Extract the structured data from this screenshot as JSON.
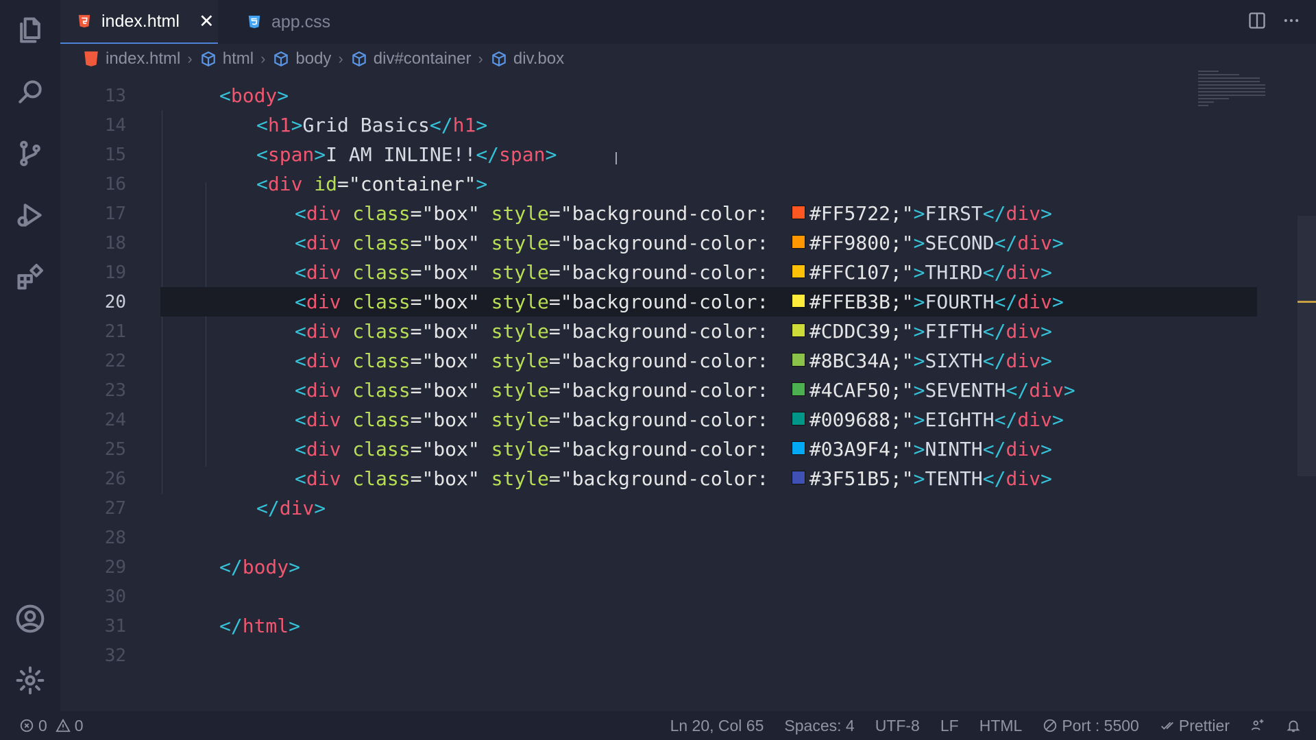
{
  "tabs": [
    {
      "label": "index.html",
      "icon": "html5-icon",
      "active": true
    },
    {
      "label": "app.css",
      "icon": "css3-icon",
      "active": false
    }
  ],
  "breadcrumbs": [
    "index.html",
    "html",
    "body",
    "div#container",
    "div.box"
  ],
  "lines": [
    {
      "n": "13"
    },
    {
      "n": "14"
    },
    {
      "n": "15"
    },
    {
      "n": "16"
    },
    {
      "n": "17"
    },
    {
      "n": "18"
    },
    {
      "n": "19"
    },
    {
      "n": "20"
    },
    {
      "n": "21"
    },
    {
      "n": "22"
    },
    {
      "n": "23"
    },
    {
      "n": "24"
    },
    {
      "n": "25"
    },
    {
      "n": "26"
    },
    {
      "n": "27"
    },
    {
      "n": "28"
    },
    {
      "n": "29"
    },
    {
      "n": "30"
    },
    {
      "n": "31"
    },
    {
      "n": "32"
    }
  ],
  "code": {
    "body_open": "body",
    "h1_text": "Grid Basics",
    "span_text": "I AM INLINE!!",
    "container_id": "\"container\"",
    "box_class": "\"box\"",
    "style_prefix": "\"background-color: ",
    "boxes": [
      {
        "color": "#FF5722",
        "label": "FIRST"
      },
      {
        "color": "#FF9800",
        "label": "SECOND"
      },
      {
        "color": "#FFC107",
        "label": "THIRD"
      },
      {
        "color": "#FFEB3B",
        "label": "FOURTH"
      },
      {
        "color": "#CDDC39",
        "label": "FIFTH"
      },
      {
        "color": "#8BC34A",
        "label": "SIXTH"
      },
      {
        "color": "#4CAF50",
        "label": "SEVENTH"
      },
      {
        "color": "#009688",
        "label": "EIGHTH"
      },
      {
        "color": "#03A9F4",
        "label": "NINTH"
      },
      {
        "color": "#3F51B5",
        "label": "TENTH"
      }
    ]
  },
  "status": {
    "errors": "0",
    "warnings": "0",
    "position": "Ln 20, Col 65",
    "spaces": "Spaces: 4",
    "encoding": "UTF-8",
    "eol": "LF",
    "language": "HTML",
    "port": "Port : 5500",
    "formatter": "Prettier"
  },
  "colors": {
    "accent": "#4c83d8",
    "tag": "#f0566f",
    "bracket": "#36c2d9",
    "attribute": "#b8de55"
  }
}
